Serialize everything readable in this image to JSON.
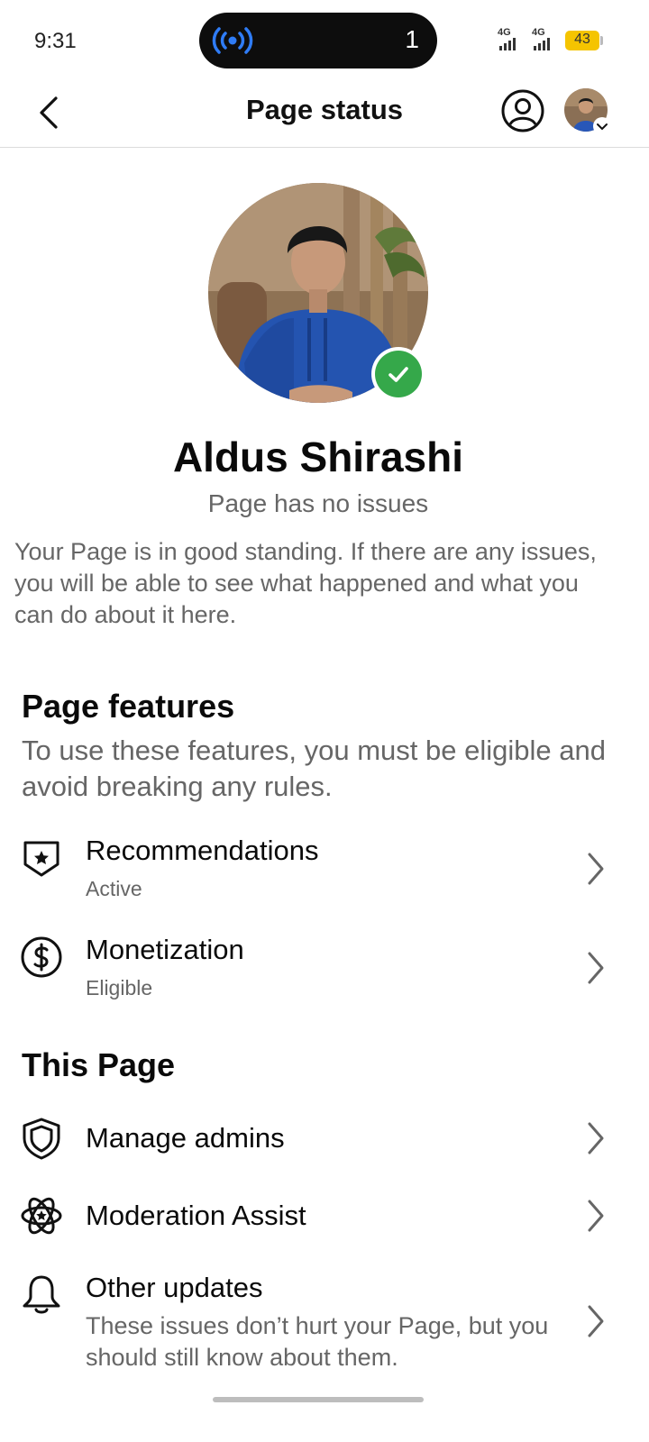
{
  "status_bar": {
    "time": "9:31",
    "island_count": "1",
    "network1": "4G",
    "network2": "4G",
    "battery": "43"
  },
  "header": {
    "title": "Page status"
  },
  "profile": {
    "name": "Aldus Shirashi",
    "status": "Page has no issues",
    "description": "Your Page is in good standing. If there are any issues, you will be able to see what happened and what you can do about it here."
  },
  "page_features": {
    "title": "Page features",
    "subtitle": "To use these features, you must be eligible and avoid breaking any rules.",
    "items": [
      {
        "label": "Recommendations",
        "sub": "Active",
        "icon": "shield-star-icon"
      },
      {
        "label": "Monetization",
        "sub": "Eligible",
        "icon": "dollar-circle-icon"
      }
    ]
  },
  "this_page": {
    "title": "This Page",
    "items": [
      {
        "label": "Manage admins",
        "icon": "shield-icon"
      },
      {
        "label": "Moderation Assist",
        "icon": "atom-star-icon"
      },
      {
        "label": "Other updates",
        "sub": "These issues don’t hurt your Page, but you should still know about them.",
        "icon": "bell-icon"
      }
    ]
  },
  "colors": {
    "verified_green": "#35a84a",
    "cast_blue": "#2f7cf6",
    "battery_yellow": "#f5c400"
  }
}
